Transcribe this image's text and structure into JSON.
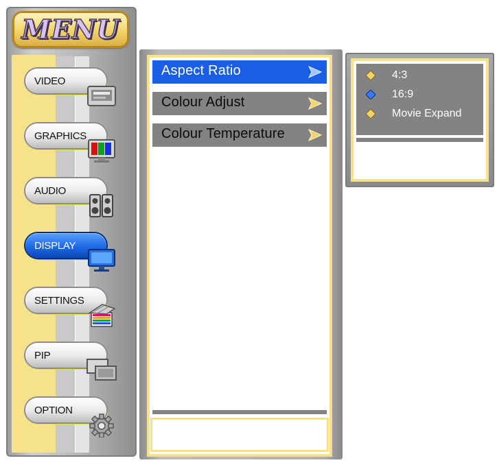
{
  "menu": {
    "title": "MENU",
    "items": [
      {
        "label": "VIDEO",
        "icon": "video-icon",
        "active": false
      },
      {
        "label": "GRAPHICS",
        "icon": "graphics-icon",
        "active": false
      },
      {
        "label": "AUDIO",
        "icon": "speaker-icon",
        "active": false
      },
      {
        "label": "DISPLAY",
        "icon": "display-icon",
        "active": true
      },
      {
        "label": "SETTINGS",
        "icon": "settings-icon",
        "active": false
      },
      {
        "label": "PIP",
        "icon": "pip-icon",
        "active": false
      },
      {
        "label": "OPTION",
        "icon": "gear-icon",
        "active": false
      }
    ]
  },
  "submenu": {
    "items": [
      {
        "label": "Aspect Ratio",
        "selected": true
      },
      {
        "label": "Colour Adjust",
        "selected": false
      },
      {
        "label": "Colour Temperature",
        "selected": false
      }
    ]
  },
  "options": {
    "items": [
      {
        "label": "4:3",
        "selected": false
      },
      {
        "label": "16:9",
        "selected": true
      },
      {
        "label": "Movie Expand",
        "selected": false
      }
    ]
  },
  "colors": {
    "selected_blue": "#1a5ee6",
    "frame_yellow": "#f6e28a",
    "item_gray": "#838383"
  }
}
